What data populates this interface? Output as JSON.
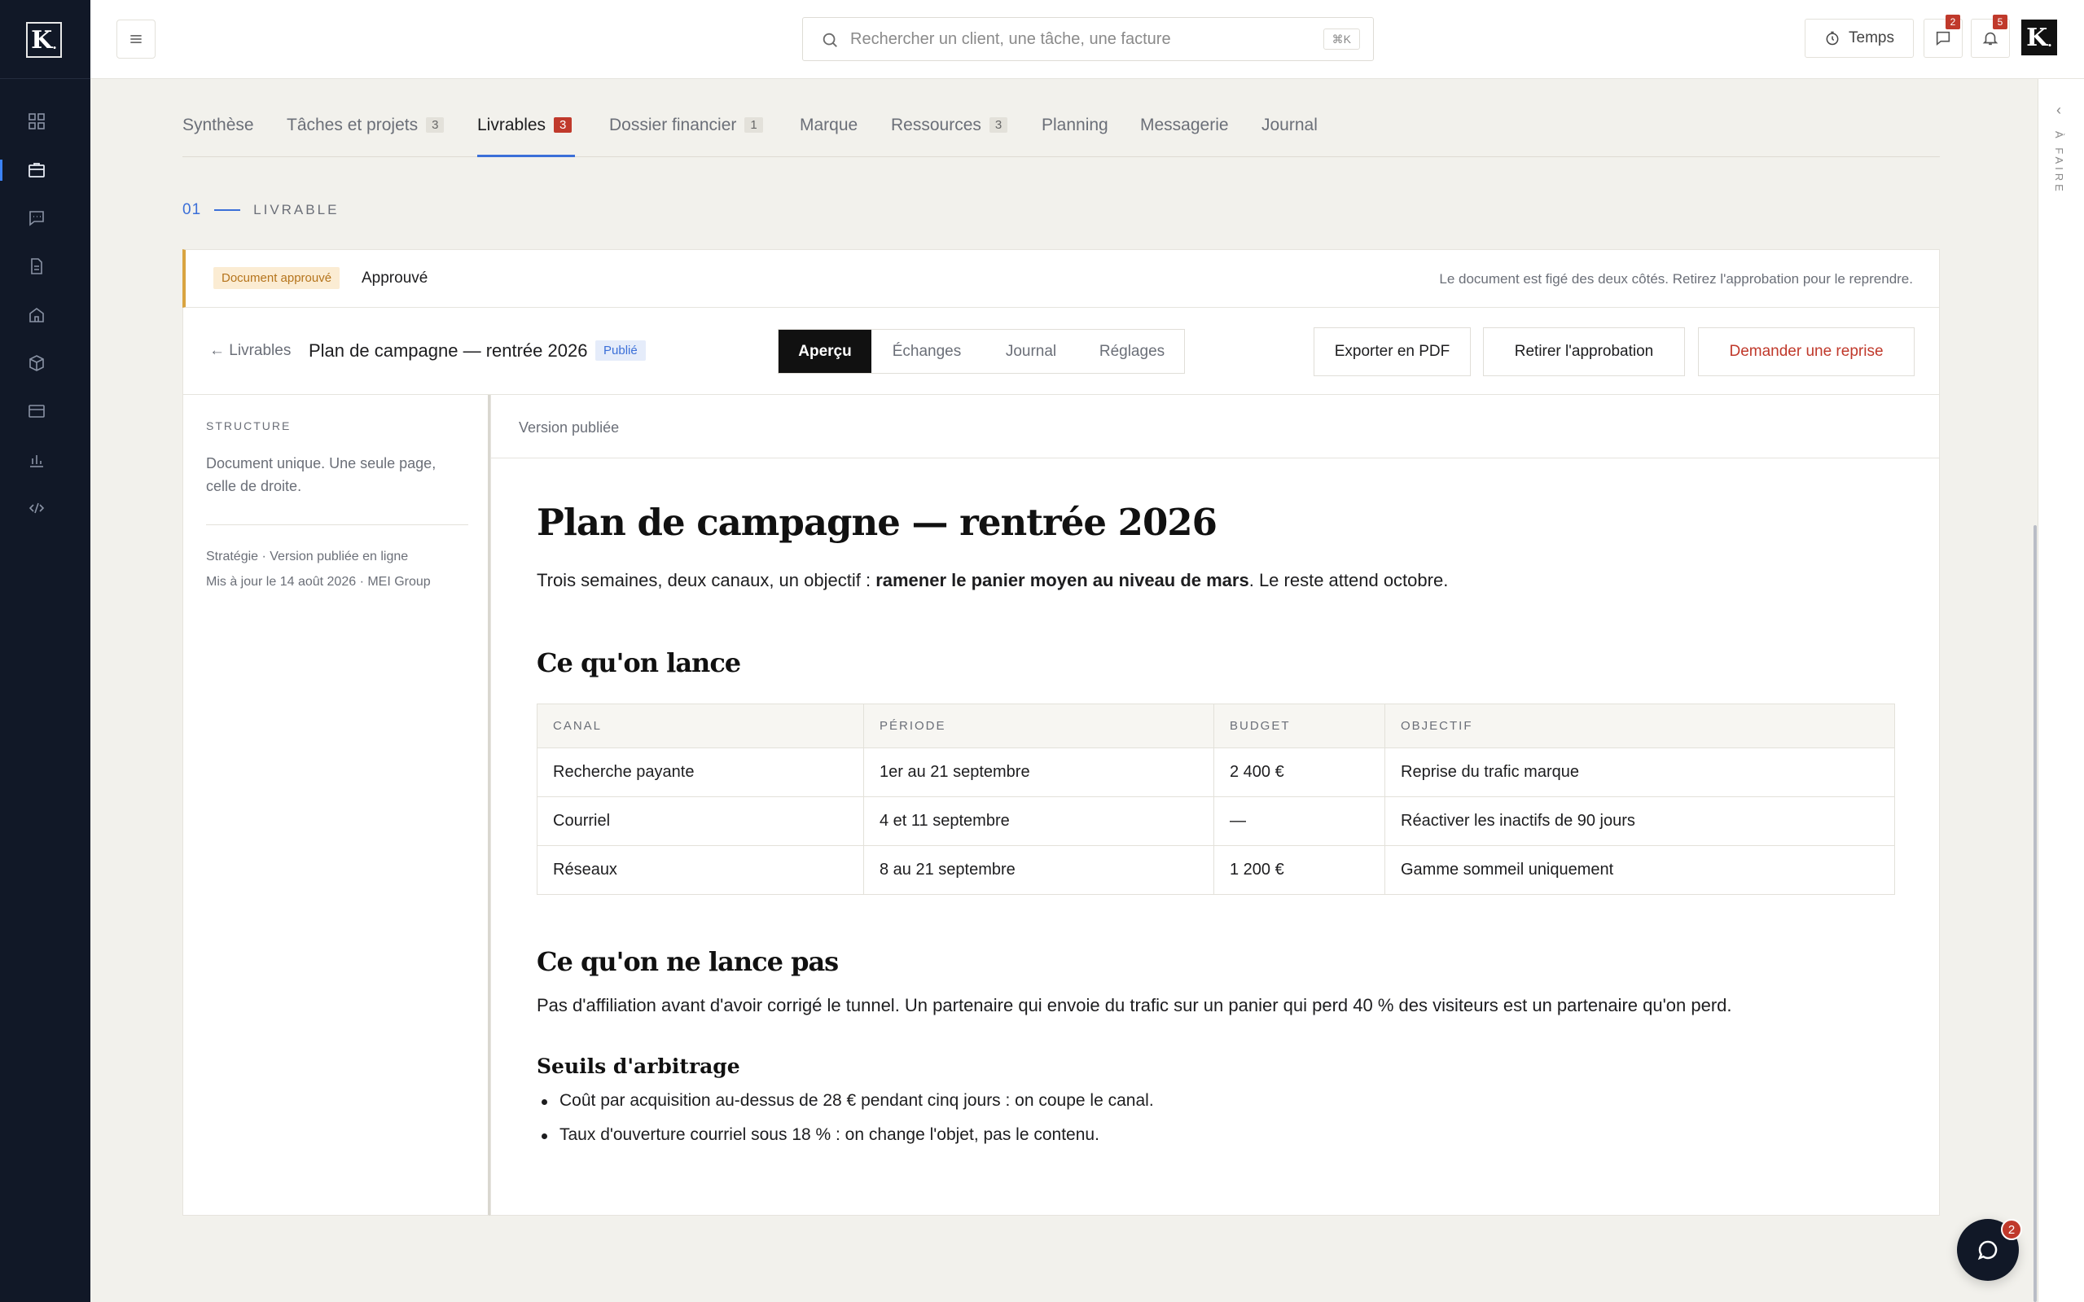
{
  "brand": {
    "logo_letter": "K",
    "logo_dot": "."
  },
  "header": {
    "search_placeholder": "Rechercher un client, une tâche, une facture",
    "search_shortcut": "⌘K",
    "temps_label": "Temps",
    "messages_badge": "2",
    "notifications_badge": "5",
    "avatar_letter": "K",
    "avatar_dot": "."
  },
  "sidebar": {
    "icons": [
      "grid-icon",
      "briefcase-icon",
      "chat-icon",
      "document-icon",
      "building-icon",
      "cube-icon",
      "card-icon",
      "chart-icon",
      "code-icon"
    ],
    "active_index": 1
  },
  "tabs": [
    {
      "label": "Synthèse",
      "count": ""
    },
    {
      "label": "Tâches et projets",
      "count": "3"
    },
    {
      "label": "Livrables",
      "count": "3"
    },
    {
      "label": "Dossier financier",
      "count": "1"
    },
    {
      "label": "Marque",
      "count": ""
    },
    {
      "label": "Ressources",
      "count": "3"
    },
    {
      "label": "Planning",
      "count": ""
    },
    {
      "label": "Messagerie",
      "count": ""
    },
    {
      "label": "Journal",
      "count": ""
    }
  ],
  "active_tab": "Livrables",
  "section": {
    "number": "01",
    "title": "LIVRABLE"
  },
  "approval": {
    "pill": "Document approuvé",
    "status": "Approuvé",
    "note": "Le document est figé des deux côtés. Retirez l'approbation pour le reprendre."
  },
  "doc_header": {
    "back": "← Livrables",
    "title": "Plan de campagne — rentrée 2026",
    "status_pill": "Publié",
    "segments": [
      "Aperçu",
      "Échanges",
      "Journal",
      "Réglages"
    ],
    "active_segment": "Aperçu",
    "export_label": "Exporter en PDF",
    "withdraw_label": "Retirer l'approbation",
    "rework_label": "Demander une reprise"
  },
  "side": {
    "heading": "STRUCTURE",
    "description": "Document unique. Une seule page, celle de droite.",
    "meta_line1": "Stratégie · Version publiée en ligne",
    "meta_line2": "Mis à jour le 14 août 2026 · MEI Group"
  },
  "doc": {
    "version_label": "Version publiée",
    "title": "Plan de campagne — rentrée 2026",
    "lead_before": "Trois semaines, deux canaux, un objectif : ",
    "lead_bold": "ramener le panier moyen au niveau de mars",
    "lead_after": ". Le reste attend octobre.",
    "h2_launch": "Ce qu'on lance",
    "table": {
      "headers": [
        "CANAL",
        "PÉRIODE",
        "BUDGET",
        "OBJECTIF"
      ],
      "rows": [
        [
          "Recherche payante",
          "1er au 21 septembre",
          "2 400 €",
          "Reprise du trafic marque"
        ],
        [
          "Courriel",
          "4 et 11 septembre",
          "—",
          "Réactiver les inactifs de 90 jours"
        ],
        [
          "Réseaux",
          "8 au 21 septembre",
          "1 200 €",
          "Gamme sommeil uniquement"
        ]
      ]
    },
    "h2_not_launch": "Ce qu'on ne lance pas",
    "not_launch_text": "Pas d'affiliation avant d'avoir corrigé le tunnel. Un partenaire qui envoie du trafic sur un panier qui perd 40 % des visiteurs est un partenaire qu'on perd.",
    "h3_thresholds": "Seuils d'arbitrage",
    "thresholds": [
      "Coût par acquisition au-dessus de 28 € pendant cinq jours : on coupe le canal.",
      "Taux d'ouverture courriel sous 18 % : on change l'objet, pas le contenu."
    ]
  },
  "todo_rail": {
    "label": "À FAIRE"
  },
  "chat": {
    "badge": "2"
  }
}
